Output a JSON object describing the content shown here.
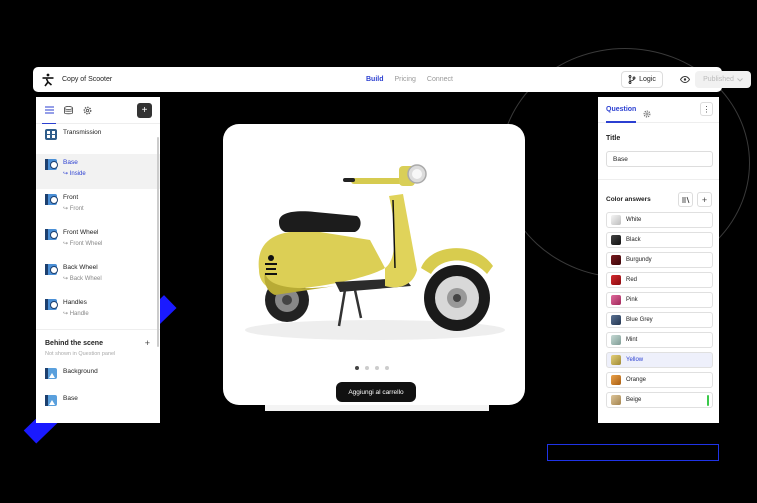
{
  "app": {
    "title": "Copy of Scooter",
    "tabs": [
      {
        "label": "Build",
        "active": true
      },
      {
        "label": "Pricing",
        "active": false
      },
      {
        "label": "Connect",
        "active": false
      }
    ],
    "logic_label": "Logic",
    "publish_label": "Published"
  },
  "left_panel": {
    "layers": [
      {
        "name": "Transmission",
        "sub": "",
        "icon": "group"
      },
      {
        "name": "Base",
        "sub": "↪ Inside",
        "icon": "part",
        "selected": true
      },
      {
        "name": "Front",
        "sub": "↪ Front",
        "icon": "part"
      },
      {
        "name": "Front Wheel",
        "sub": "↪ Front Wheel",
        "icon": "part"
      },
      {
        "name": "Back Wheel",
        "sub": "↪ Back Wheel",
        "icon": "part"
      },
      {
        "name": "Handles",
        "sub": "↪ Handle",
        "icon": "part"
      }
    ],
    "behind_scene": {
      "title": "Behind the scene",
      "subtitle": "Not shown in Question panel",
      "items": [
        {
          "name": "Background",
          "icon": "image"
        },
        {
          "name": "Base",
          "icon": "image"
        }
      ]
    }
  },
  "viewer": {
    "image_subject": "yellow vintage scooter",
    "carousel_count": 4,
    "carousel_active": 1,
    "cart_button_label": "Aggiungi al carrello"
  },
  "right_panel": {
    "tab_label": "Question",
    "title_label": "Title",
    "title_value": "Base",
    "answers_label": "Color answers",
    "answers": [
      {
        "label": "White",
        "color": "#e2e2e2"
      },
      {
        "label": "Black",
        "color": "#1e1e1e"
      },
      {
        "label": "Burgundy",
        "color": "#5c0d12"
      },
      {
        "label": "Red",
        "color": "#b01218"
      },
      {
        "label": "Pink",
        "color": "#c8407a"
      },
      {
        "label": "Blue Grey",
        "color": "#3d5272"
      },
      {
        "label": "Mint",
        "color": "#9db8b2"
      },
      {
        "label": "Yellow",
        "color": "#c9b25a",
        "selected": true
      },
      {
        "label": "Orange",
        "color": "#d0822a"
      },
      {
        "label": "Beige",
        "color": "#c6a777"
      }
    ]
  }
}
